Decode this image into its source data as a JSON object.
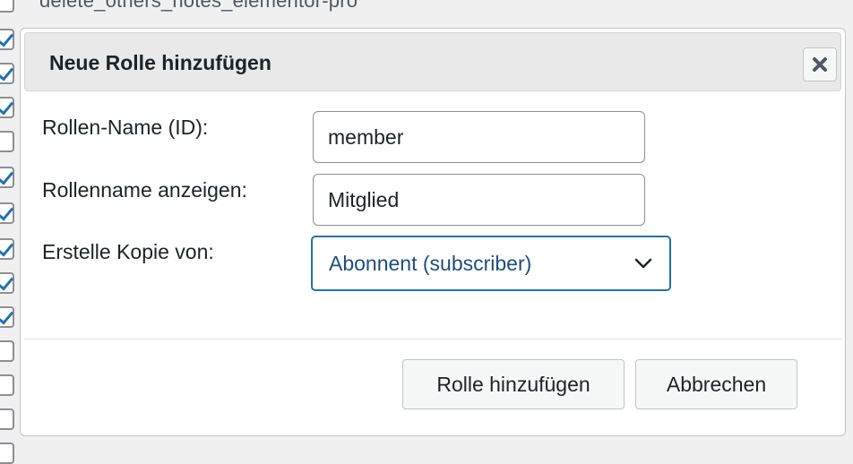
{
  "background": {
    "capability_label": "delete_others_notes_elementor-pro"
  },
  "dialog": {
    "title": "Neue Rolle hinzufügen",
    "close_icon": "close-icon",
    "fields": {
      "role_id": {
        "label": "Rollen-Name (ID):",
        "value": "member"
      },
      "display_name": {
        "label": "Rollenname anzeigen:",
        "value": "Mitglied"
      },
      "copy_from": {
        "label": "Erstelle Kopie von:",
        "selected": "Abonnent (subscriber)"
      }
    },
    "buttons": {
      "add": "Rolle hinzufügen",
      "cancel": "Abbrechen"
    }
  },
  "colors": {
    "accent": "#2271b1",
    "select_text": "#1d4d80"
  }
}
